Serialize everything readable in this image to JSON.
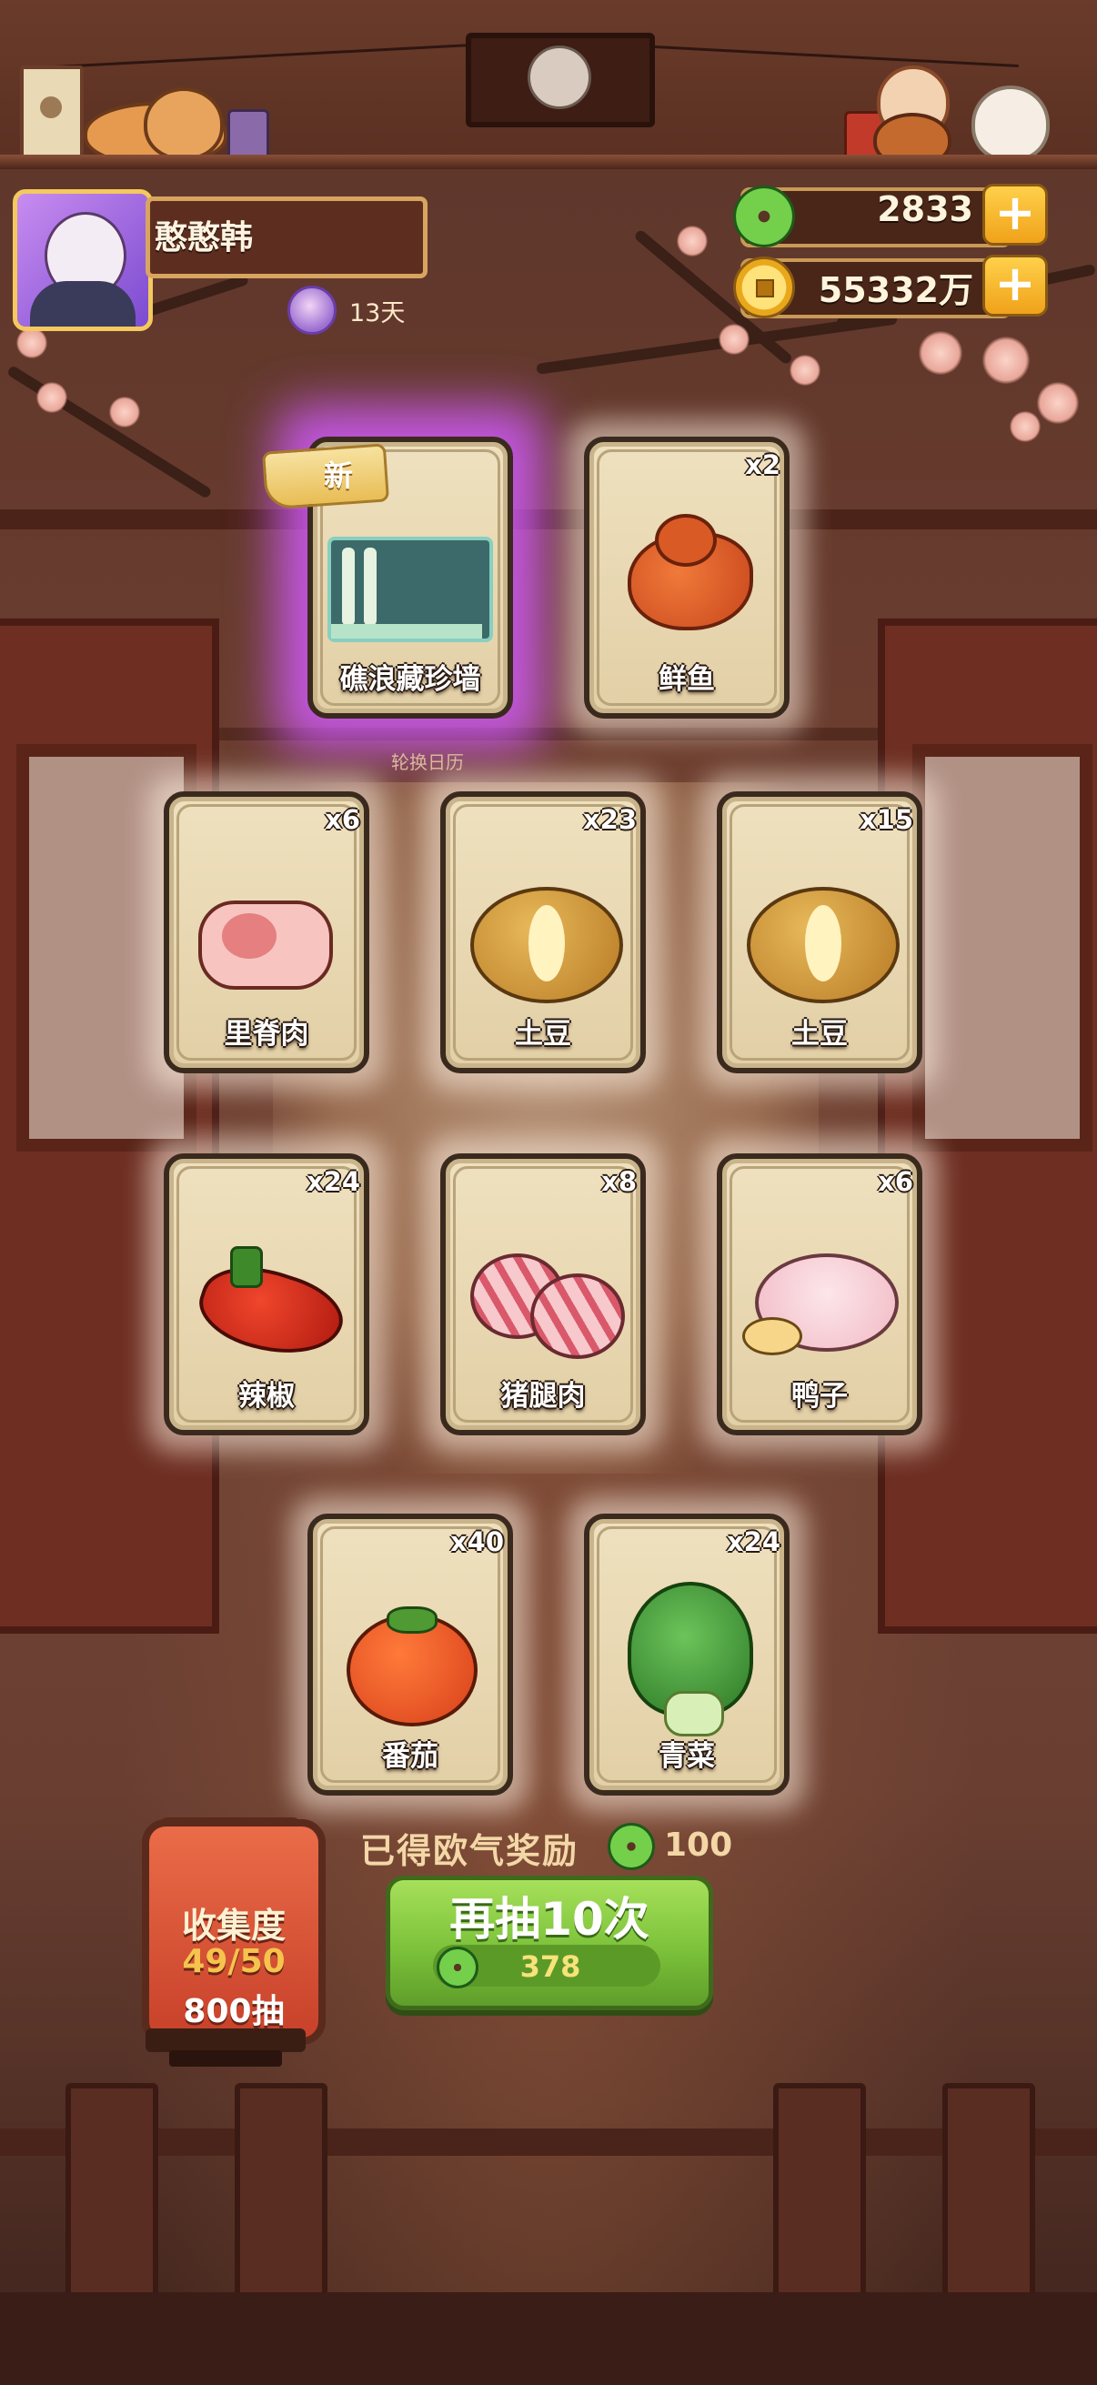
{
  "player": {
    "name": "憨憨韩",
    "days": "13天"
  },
  "currency": {
    "jade": "2833",
    "coins": "55332万",
    "plus": "+"
  },
  "cards": [
    {
      "name": "礁浪藏珍墙",
      "count": "",
      "is_new": true,
      "new_label": "新",
      "icon": "wall-decoration-icon"
    },
    {
      "name": "鲜鱼",
      "count": "x2",
      "icon": "fish-icon"
    },
    {
      "name": "里脊肉",
      "count": "x6",
      "icon": "pork-loin-icon"
    },
    {
      "name": "土豆",
      "count": "x23",
      "icon": "potato-icon"
    },
    {
      "name": "土豆",
      "count": "x15",
      "icon": "potato-icon"
    },
    {
      "name": "辣椒",
      "count": "x24",
      "icon": "chili-icon"
    },
    {
      "name": "猪腿肉",
      "count": "x8",
      "icon": "pork-leg-icon"
    },
    {
      "name": "鸭子",
      "count": "x6",
      "icon": "duck-icon"
    },
    {
      "name": "番茄",
      "count": "x40",
      "icon": "tomato-icon"
    },
    {
      "name": "青菜",
      "count": "x24",
      "icon": "bok-choy-icon"
    }
  ],
  "sub_caption": "轮换日历",
  "reward": {
    "label": "已得欧气奖励",
    "value": "100"
  },
  "collection": {
    "title": "收集度",
    "progress": "49/50",
    "draws": "800抽"
  },
  "draw_button": {
    "label": "再抽10次",
    "cost": "378"
  }
}
